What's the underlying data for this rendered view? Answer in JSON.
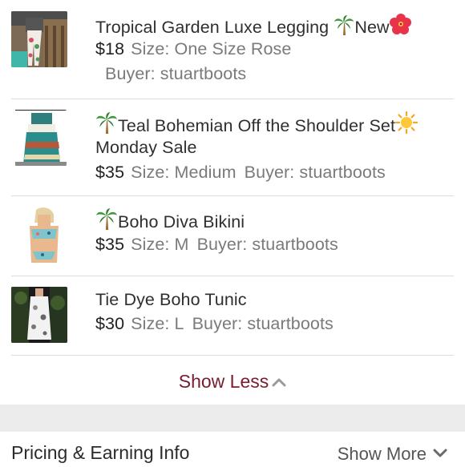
{
  "items": [
    {
      "title": "Tropical Garden Luxe Legging",
      "title_suffix": "New",
      "price": "$18",
      "size": "Size: One Size Rose",
      "buyer": "Buyer: stuartboots"
    },
    {
      "title": "Teal Bohemian Off the Shoulder Set",
      "title_line2": "Monday Sale",
      "price": "$35",
      "size": "Size: Medium",
      "buyer": "Buyer: stuartboots"
    },
    {
      "title": "Boho Diva Bikini",
      "price": "$35",
      "size": "Size: M",
      "buyer": "Buyer: stuartboots"
    },
    {
      "title": "Tie Dye Boho Tunic",
      "price": "$30",
      "size": "Size: L",
      "buyer": "Buyer: stuartboots"
    }
  ],
  "show_less_label": "Show Less",
  "pricing": {
    "title": "Pricing & Earning Info",
    "show_more_label": "Show More"
  },
  "colors": {
    "accent": "#7a1c30",
    "divider": "#dcdcdc",
    "muted_text": "#7a7a7a",
    "band": "#ececec"
  },
  "icons": [
    "palm-tree-icon",
    "hibiscus-icon",
    "sun-icon",
    "chevron-up-icon",
    "chevron-down-icon"
  ]
}
